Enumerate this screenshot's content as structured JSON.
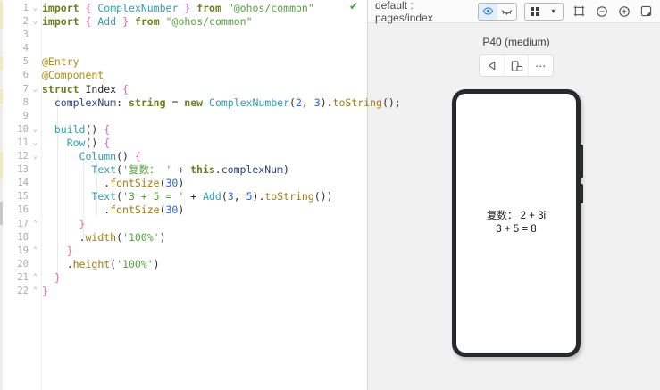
{
  "editor": {
    "inspection_check_glyph": "✔",
    "fold_open_glyph": "⌄",
    "fold_close_glyph": "⌃",
    "lines": [
      {
        "n": "1",
        "fold": "open",
        "tokens": [
          [
            "kw",
            "import"
          ],
          [
            "pl",
            " "
          ],
          [
            "br",
            "{"
          ],
          [
            "pl",
            " "
          ],
          [
            "cls",
            "ComplexNumber"
          ],
          [
            "pl",
            " "
          ],
          [
            "br",
            "}"
          ],
          [
            "pl",
            " "
          ],
          [
            "kw",
            "from"
          ],
          [
            "pl",
            " "
          ],
          [
            "str",
            "\"@ohos/common\""
          ]
        ]
      },
      {
        "n": "2",
        "fold": "open",
        "tokens": [
          [
            "kw",
            "import"
          ],
          [
            "pl",
            " "
          ],
          [
            "br",
            "{"
          ],
          [
            "pl",
            " "
          ],
          [
            "cls",
            "Add"
          ],
          [
            "pl",
            " "
          ],
          [
            "br",
            "}"
          ],
          [
            "pl",
            " "
          ],
          [
            "kw",
            "from"
          ],
          [
            "pl",
            " "
          ],
          [
            "str",
            "\"@ohos/common\""
          ]
        ]
      },
      {
        "n": "3",
        "fold": null,
        "tokens": []
      },
      {
        "n": "4",
        "fold": null,
        "tokens": []
      },
      {
        "n": "5",
        "fold": null,
        "tokens": [
          [
            "ann",
            "@Entry"
          ]
        ]
      },
      {
        "n": "6",
        "fold": null,
        "tokens": [
          [
            "ann",
            "@Component"
          ]
        ]
      },
      {
        "n": "7",
        "fold": "open",
        "tokens": [
          [
            "kw",
            "struct"
          ],
          [
            "pl",
            " Index "
          ],
          [
            "br",
            "{"
          ]
        ]
      },
      {
        "n": "8",
        "fold": null,
        "tokens": [
          [
            "pl",
            "  "
          ],
          [
            "fld",
            "complexNum"
          ],
          [
            "pl",
            ": "
          ],
          [
            "kw",
            "string"
          ],
          [
            "pl",
            " = "
          ],
          [
            "kw",
            "new"
          ],
          [
            "pl",
            " "
          ],
          [
            "cls",
            "ComplexNumber"
          ],
          [
            "pl",
            "("
          ],
          [
            "num",
            "2"
          ],
          [
            "pl",
            ", "
          ],
          [
            "num",
            "3"
          ],
          [
            "pl",
            ")."
          ],
          [
            "mth",
            "toString"
          ],
          [
            "pl",
            "();"
          ]
        ]
      },
      {
        "n": "9",
        "fold": null,
        "tokens": []
      },
      {
        "n": "10",
        "fold": "open",
        "tokens": [
          [
            "pl",
            "  "
          ],
          [
            "cls",
            "build"
          ],
          [
            "pl",
            "() "
          ],
          [
            "br",
            "{"
          ]
        ]
      },
      {
        "n": "11",
        "fold": "open",
        "tokens": [
          [
            "pl",
            "    "
          ],
          [
            "cls",
            "Row"
          ],
          [
            "pl",
            "() "
          ],
          [
            "br",
            "{"
          ]
        ]
      },
      {
        "n": "12",
        "fold": "open",
        "tokens": [
          [
            "pl",
            "      "
          ],
          [
            "cls",
            "Column"
          ],
          [
            "pl",
            "() "
          ],
          [
            "br",
            "{"
          ]
        ]
      },
      {
        "n": "13",
        "fold": null,
        "tokens": [
          [
            "pl",
            "        "
          ],
          [
            "cls",
            "Text"
          ],
          [
            "pl",
            "("
          ],
          [
            "str",
            "'复数： '"
          ],
          [
            "pl",
            " + "
          ],
          [
            "kw",
            "this"
          ],
          [
            "pl",
            "."
          ],
          [
            "fld",
            "complexNum"
          ],
          [
            "pl",
            ")"
          ]
        ]
      },
      {
        "n": "14",
        "fold": null,
        "tokens": [
          [
            "pl",
            "          ."
          ],
          [
            "mth",
            "fontSize"
          ],
          [
            "pl",
            "("
          ],
          [
            "num",
            "30"
          ],
          [
            "pl",
            ")"
          ]
        ]
      },
      {
        "n": "15",
        "fold": null,
        "tokens": [
          [
            "pl",
            "        "
          ],
          [
            "cls",
            "Text"
          ],
          [
            "pl",
            "("
          ],
          [
            "str",
            "'3 + 5 = '"
          ],
          [
            "pl",
            " + "
          ],
          [
            "cls",
            "Add"
          ],
          [
            "pl",
            "("
          ],
          [
            "num",
            "3"
          ],
          [
            "pl",
            ", "
          ],
          [
            "num",
            "5"
          ],
          [
            "pl",
            ")."
          ],
          [
            "mth",
            "toString"
          ],
          [
            "pl",
            "())"
          ]
        ]
      },
      {
        "n": "16",
        "fold": null,
        "tokens": [
          [
            "pl",
            "          ."
          ],
          [
            "mth",
            "fontSize"
          ],
          [
            "pl",
            "("
          ],
          [
            "num",
            "30"
          ],
          [
            "pl",
            ")"
          ]
        ]
      },
      {
        "n": "17",
        "fold": "close",
        "tokens": [
          [
            "pl",
            "      "
          ],
          [
            "br",
            "}"
          ]
        ]
      },
      {
        "n": "18",
        "fold": null,
        "tokens": [
          [
            "pl",
            "      ."
          ],
          [
            "mth",
            "width"
          ],
          [
            "pl",
            "("
          ],
          [
            "str",
            "'100%'"
          ],
          [
            "pl",
            ")"
          ]
        ]
      },
      {
        "n": "19",
        "fold": "close",
        "tokens": [
          [
            "pl",
            "    "
          ],
          [
            "br",
            "}"
          ]
        ]
      },
      {
        "n": "20",
        "fold": null,
        "tokens": [
          [
            "pl",
            "    ."
          ],
          [
            "mth",
            "height"
          ],
          [
            "pl",
            "("
          ],
          [
            "str",
            "'100%'"
          ],
          [
            "pl",
            ")"
          ]
        ]
      },
      {
        "n": "21",
        "fold": "close",
        "tokens": [
          [
            "pl",
            "  "
          ],
          [
            "br",
            "}"
          ]
        ]
      },
      {
        "n": "22",
        "fold": "close",
        "tokens": [
          [
            "br",
            "}"
          ]
        ]
      }
    ]
  },
  "preview": {
    "header": {
      "title": "default : pages/index",
      "dropdown_chevron_glyph": "▾",
      "icons": [
        {
          "name": "preview-eye-icon"
        },
        {
          "name": "inspector-eye-closed-icon"
        },
        {
          "name": "grid-view-icon"
        },
        {
          "name": "fit-frame-icon"
        },
        {
          "name": "zoom-out-icon"
        },
        {
          "name": "zoom-in-icon"
        },
        {
          "name": "open-window-icon"
        }
      ]
    },
    "device_label": "P40 (medium)",
    "nav": {
      "back_icon": "back-icon",
      "rotate_icon": "rotate-device-icon",
      "more_glyph": "⋯"
    },
    "screen": {
      "lines": [
        "复数： 2 + 3i",
        "3 + 5 = 8"
      ]
    }
  },
  "colors": {
    "accent_blue": "#3d7ff0",
    "check_green": "#46a24a",
    "keyword_olive": "#6b7f1e",
    "annotation_gold": "#b08d10",
    "class_teal": "#2d9cad",
    "string_green": "#55a13e",
    "number_blue": "#2c63e8",
    "brace_pink": "#ea63ae",
    "phone_frame": "#27292b",
    "panel_bg": "#f1f1f2"
  }
}
